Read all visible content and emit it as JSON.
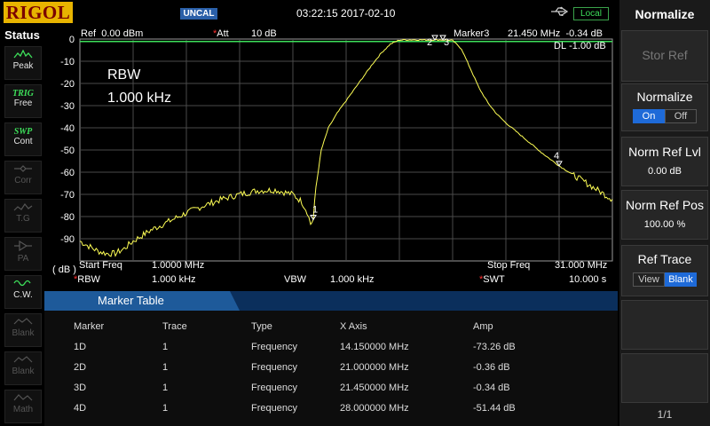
{
  "header": {
    "logo": "RIGOL",
    "uncal": "UNCAL",
    "datetime": "03:22:15 2017-02-10",
    "usb_icon": "usb-icon",
    "local": "Local"
  },
  "status": {
    "title": "Status",
    "buttons": [
      {
        "name": "peak",
        "icon": "peak-icon",
        "label": "Peak",
        "active": true
      },
      {
        "name": "trig",
        "icon": "TRIG",
        "label": "Free",
        "active": true
      },
      {
        "name": "swp",
        "icon": "SWP",
        "label": "Cont",
        "active": true
      },
      {
        "name": "corr",
        "icon": "corr-icon",
        "label": "Corr",
        "active": false
      },
      {
        "name": "tg",
        "icon": "tg-icon",
        "label": "T.G",
        "active": false
      },
      {
        "name": "pa",
        "icon": "pa-icon",
        "label": "PA",
        "active": false
      },
      {
        "name": "cw",
        "icon": "cw-icon",
        "label": "C.W.",
        "active": true
      },
      {
        "name": "blank1",
        "icon": "blank-icon",
        "label": "Blank",
        "active": false
      },
      {
        "name": "blank2",
        "icon": "blank-icon",
        "label": "Blank",
        "active": false
      },
      {
        "name": "math",
        "icon": "math-icon",
        "label": "Math",
        "active": false
      }
    ]
  },
  "plot": {
    "ref_label": "Ref",
    "ref_value": "0.00 dBm",
    "att_label": "Att",
    "att_value": "10 dB",
    "marker_label": "Marker3",
    "marker_freq": "21.450 MHz",
    "marker_amp": "-0.34 dB",
    "dl_label": "DL",
    "dl_value": "-1.00 dB",
    "rbw_note_1": "RBW",
    "rbw_note_2": "1.000 kHz",
    "unit_label": "( dB )",
    "start_label": "Start Freq",
    "start_value": "1.0000 MHz",
    "stop_label": "Stop Freq",
    "stop_value": "31.000 MHz",
    "rbw_label": "RBW",
    "rbw_value": "1.000 kHz",
    "vbw_label": "VBW",
    "vbw_value": "1.000 kHz",
    "swt_label": "SWT",
    "swt_value": "10.000 s",
    "y_ticks": [
      "0",
      "-10",
      "-20",
      "-30",
      "-40",
      "-50",
      "-60",
      "-70",
      "-80",
      "-90"
    ],
    "marker_numbers": [
      "1",
      "2",
      "3",
      "4"
    ],
    "trace_color": "#ffff55",
    "dl_color": "#3ddf5a"
  },
  "chart_data": {
    "type": "line",
    "x_unit": "MHz",
    "y_unit": "dB",
    "xlim": [
      1,
      31
    ],
    "ylim": [
      -90,
      0
    ],
    "grid": true,
    "series": [
      {
        "x": [
          1,
          1.5,
          2,
          2.5,
          3,
          3.5,
          4,
          5,
          6,
          7,
          8,
          9,
          10,
          11,
          12,
          13,
          13.5,
          13.8,
          14.0,
          14.15,
          14.3,
          14.6,
          15,
          15.5,
          16,
          16.5,
          17,
          17.5,
          18,
          18.5,
          19,
          19.5,
          20,
          20.5,
          21,
          21.45,
          22,
          22.5,
          23,
          23.5,
          24,
          24.5,
          25,
          25.5,
          26,
          27,
          28,
          29,
          30,
          31
        ],
        "y": [
          -82,
          -84,
          -86,
          -87,
          -87,
          -85,
          -82,
          -77.5,
          -74,
          -70.5,
          -67.5,
          -65,
          -63,
          -61.5,
          -61.2,
          -63,
          -66,
          -70,
          -75,
          -73.26,
          -60,
          -45,
          -36,
          -30,
          -25,
          -20,
          -15,
          -10,
          -5.5,
          -2,
          -0.4,
          -0.3,
          -0.3,
          -0.35,
          -0.36,
          -0.34,
          -0.6,
          -4,
          -12,
          -20,
          -26,
          -30.5,
          -34,
          -37,
          -40,
          -46,
          -51.44,
          -56,
          -60.5,
          -65
        ]
      }
    ],
    "markers": [
      {
        "id": "1D",
        "trace": "1",
        "type": "Frequency",
        "x": 14.15,
        "y": -73.26
      },
      {
        "id": "2D",
        "trace": "1",
        "type": "Frequency",
        "x": 21.0,
        "y": -0.36
      },
      {
        "id": "3D",
        "trace": "1",
        "type": "Frequency",
        "x": 21.45,
        "y": -0.34
      },
      {
        "id": "4D",
        "trace": "1",
        "type": "Frequency",
        "x": 28.0,
        "y": -51.44
      }
    ],
    "display_line": -1.0
  },
  "marker_table": {
    "title": "Marker Table",
    "columns": [
      "Marker",
      "Trace",
      "Type",
      "X Axis",
      "Amp"
    ],
    "rows": [
      [
        "1D",
        "1",
        "Frequency",
        "14.150000 MHz",
        "-73.26 dB"
      ],
      [
        "2D",
        "1",
        "Frequency",
        "21.000000 MHz",
        "-0.36 dB"
      ],
      [
        "3D",
        "1",
        "Frequency",
        "21.450000 MHz",
        "-0.34 dB"
      ],
      [
        "4D",
        "1",
        "Frequency",
        "28.000000 MHz",
        "-51.44 dB"
      ]
    ]
  },
  "softkeys": {
    "menu_title": "Normalize",
    "stor_ref": "Stor Ref",
    "normalize_title": "Normalize",
    "on": "On",
    "off": "Off",
    "norm_ref_lvl": "Norm Ref Lvl",
    "norm_ref_lvl_value": "0.00 dB",
    "norm_ref_pos": "Norm Ref Pos",
    "norm_ref_pos_value": "100.00 %",
    "ref_trace": "Ref Trace",
    "view": "View",
    "blank": "Blank",
    "page": "1/1"
  }
}
